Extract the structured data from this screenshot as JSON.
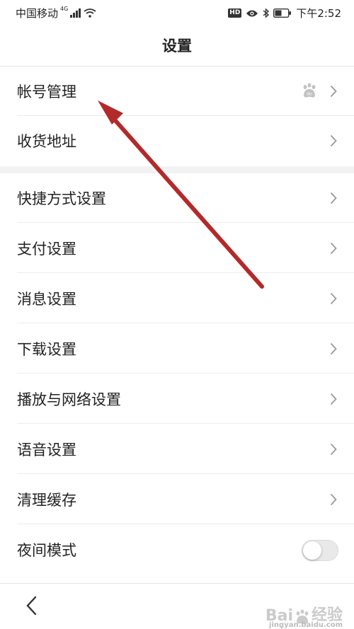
{
  "status_bar": {
    "carrier": "中国移动",
    "network": "4G",
    "hd": "HD",
    "time": "下午2:52"
  },
  "page": {
    "title": "设置"
  },
  "settings_items": [
    {
      "label": "帐号管理"
    },
    {
      "label": "收货地址"
    },
    {
      "label": "快捷方式设置"
    },
    {
      "label": "支付设置"
    },
    {
      "label": "消息设置"
    },
    {
      "label": "下载设置"
    },
    {
      "label": "播放与网络设置"
    },
    {
      "label": "语音设置"
    },
    {
      "label": "清理缓存"
    },
    {
      "label": "夜间模式"
    }
  ],
  "night_mode": {
    "enabled": false
  },
  "icons": {
    "back": "chevron-left-icon",
    "row_arrow": "chevron-right-icon",
    "account_badge": "baidu-paw-icon"
  },
  "colors": {
    "annotation_arrow": "#b22a2a",
    "chevron": "#9a9a9a",
    "divider": "#ececec",
    "section_gap": "#f2f2f2"
  },
  "watermark": {
    "text": "Bai",
    "text_cn": "经验",
    "sub": "jingyan.baidu.com"
  }
}
